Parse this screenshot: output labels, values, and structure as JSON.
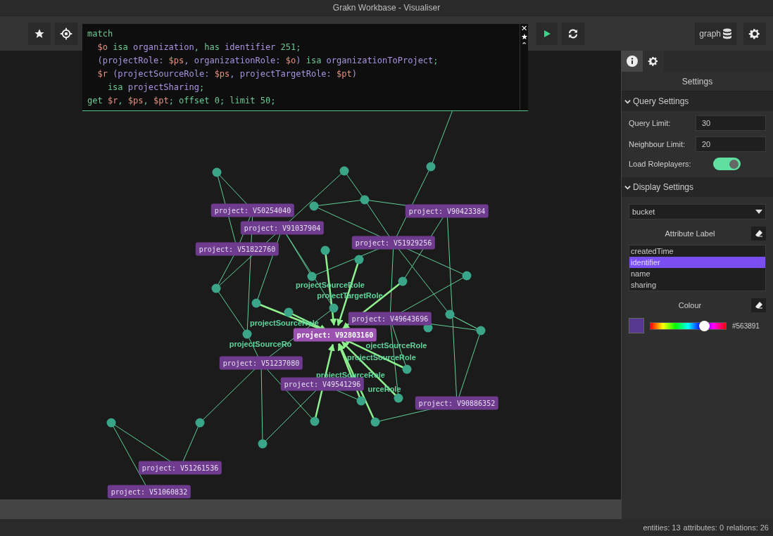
{
  "window": {
    "title": "Grakn Workbase - Visualiser"
  },
  "query": {
    "lines": [
      [
        {
          "text": "match",
          "kind": "keyword"
        }
      ],
      [
        {
          "text": "  $o",
          "kind": "variable"
        },
        {
          "text": " isa ",
          "kind": "keyword"
        },
        {
          "text": "organization",
          "kind": "type"
        },
        {
          "text": ", has ",
          "kind": "keyword"
        },
        {
          "text": "identifier",
          "kind": "type"
        },
        {
          "text": " 251;",
          "kind": "keyword"
        }
      ],
      [
        {
          "text": "  (projectRole: ",
          "kind": "type"
        },
        {
          "text": "$ps",
          "kind": "variable"
        },
        {
          "text": ", organizationRole: ",
          "kind": "type"
        },
        {
          "text": "$o",
          "kind": "variable"
        },
        {
          "text": ") ",
          "kind": "type"
        },
        {
          "text": "isa ",
          "kind": "keyword"
        },
        {
          "text": "organizationToProject",
          "kind": "type"
        },
        {
          "text": ";",
          "kind": "keyword"
        }
      ],
      [
        {
          "text": "  $r",
          "kind": "variable"
        },
        {
          "text": " (projectSourceRole: ",
          "kind": "type"
        },
        {
          "text": "$ps",
          "kind": "variable"
        },
        {
          "text": ", projectTargetRole: ",
          "kind": "type"
        },
        {
          "text": "$pt",
          "kind": "variable"
        },
        {
          "text": ")",
          "kind": "type"
        }
      ],
      [
        {
          "text": "    isa ",
          "kind": "keyword"
        },
        {
          "text": "projectSharing",
          "kind": "type"
        },
        {
          "text": ";",
          "kind": "keyword"
        }
      ],
      [
        {
          "text": "get ",
          "kind": "keyword"
        },
        {
          "text": "$r",
          "kind": "variable"
        },
        {
          "text": ", ",
          "kind": "keyword"
        },
        {
          "text": "$ps",
          "kind": "variable"
        },
        {
          "text": ", ",
          "kind": "keyword"
        },
        {
          "text": "$pt",
          "kind": "variable"
        },
        {
          "text": "; offset 0; limit 50;",
          "kind": "keyword"
        }
      ]
    ]
  },
  "editor_controls": {
    "close": "✕",
    "star": "★",
    "collapse": "⌃"
  },
  "keyspace_button": {
    "label": "graph"
  },
  "graph": {
    "nodes": [
      {
        "label": "project: V50254040",
        "selected": false
      },
      {
        "label": "project: V91037904",
        "selected": false
      },
      {
        "label": "project: V51822760",
        "selected": false
      },
      {
        "label": "project: V90423384",
        "selected": false
      },
      {
        "label": "project: V51929256",
        "selected": false
      },
      {
        "label": "project: V49643696",
        "selected": false
      },
      {
        "label": "project: V92803160",
        "selected": true
      },
      {
        "label": "project: V51237080",
        "selected": false
      },
      {
        "label": "project: V49541296",
        "selected": false
      },
      {
        "label": "project: V90886352",
        "selected": false
      },
      {
        "label": "project: V51261536",
        "selected": false
      },
      {
        "label": "project: V51060832",
        "selected": false
      }
    ],
    "edge_labels": [
      "projectSourceRole",
      "projectTargetRole",
      "projectSourceRole",
      "projectSourceRo",
      "ojectSourceRole",
      "projectSourceRole",
      "projectSourceRole",
      "urceRole"
    ]
  },
  "panel": {
    "tabs": [
      {
        "selected": false
      },
      {
        "selected": true
      }
    ],
    "title": "Settings",
    "query_settings": {
      "heading": "Query Settings",
      "expanded": true,
      "query_limit": {
        "label": "Query Limit:",
        "value": "30"
      },
      "neighbour_limit": {
        "label": "Neighbour Limit:",
        "value": "20"
      },
      "load_roleplayers": {
        "label": "Load Roleplayers:",
        "on": true
      }
    },
    "display_settings": {
      "heading": "Display Settings",
      "expanded": true,
      "type_select": {
        "value": "bucket"
      },
      "attribute_label": {
        "title": "Attribute Label",
        "items": [
          {
            "label": "createdTime",
            "selected": false
          },
          {
            "label": "identifier",
            "selected": true
          },
          {
            "label": "name",
            "selected": false
          },
          {
            "label": "sharing",
            "selected": false
          }
        ]
      },
      "colour": {
        "title": "Colour",
        "color": "#563891",
        "level": 0.71,
        "hex": "#563891"
      }
    }
  },
  "status_bar": {
    "entities": "entities: 13",
    "attributes": "attributes: 0",
    "relations": "relations: 26"
  }
}
